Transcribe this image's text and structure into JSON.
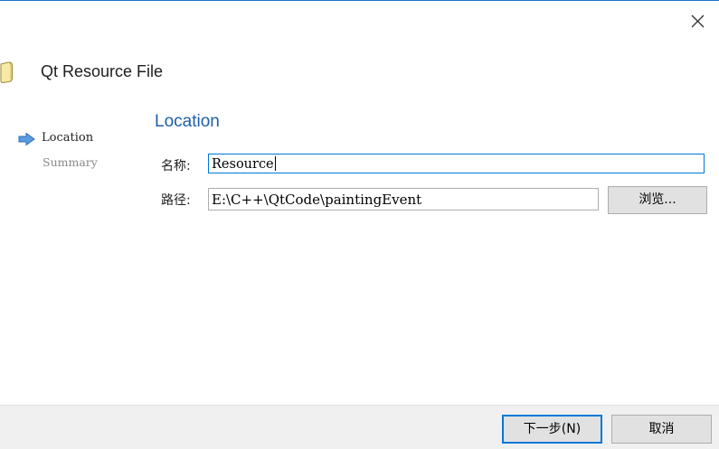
{
  "window": {
    "close_icon": "close-icon",
    "accent_color": "#0078d7"
  },
  "header": {
    "title": "Qt Resource File",
    "icon": "resource-file-icon"
  },
  "steps": [
    {
      "label": "Location",
      "state": "current",
      "icon": "arrow-right-icon"
    },
    {
      "label": "Summary",
      "state": "inactive"
    }
  ],
  "page": {
    "title": "Location",
    "title_color": "#1f5fa8"
  },
  "form": {
    "name_label": "名称:",
    "name_value": "Resource",
    "path_label": "路径:",
    "path_value": "E:\\C++\\QtCode\\paintingEvent",
    "browse_label": "浏览..."
  },
  "footer": {
    "next_label": "下一步(N)",
    "cancel_label": "取消"
  }
}
